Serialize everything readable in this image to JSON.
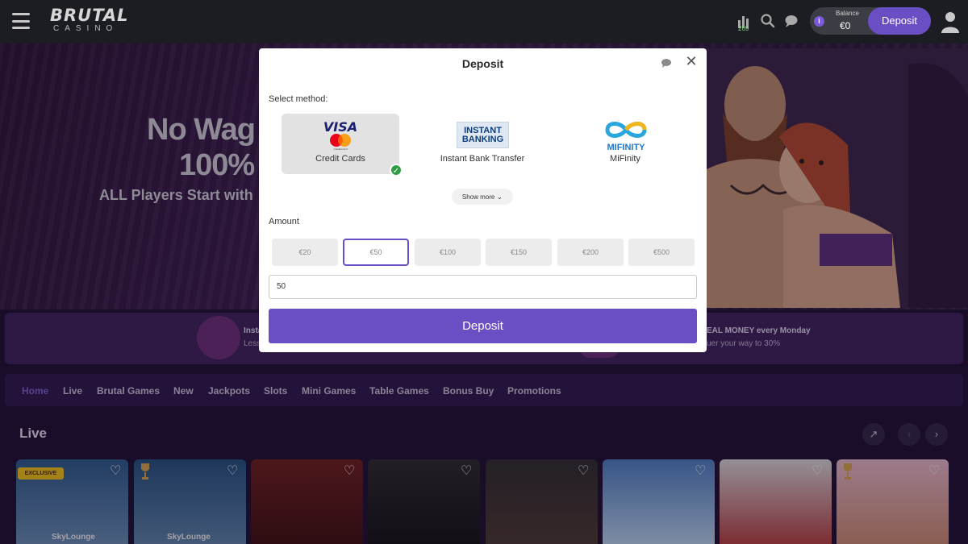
{
  "header": {
    "logo_main": "BRUTAL",
    "logo_sub": "CASINO",
    "stats_count": "269",
    "balance_label": "Balance",
    "balance_value": "€0",
    "deposit_label": "Deposit"
  },
  "hero": {
    "line1": "No Wag",
    "line2": "100%",
    "line3": "ALL Players Start with"
  },
  "promo": {
    "left_title": "Insta",
    "left_sub": "Less",
    "right_title": "EAL MONEY every Monday",
    "right_sub": "uer your way to 30%"
  },
  "nav": {
    "items": [
      "Home",
      "Live",
      "Brutal Games",
      "New",
      "Jackpots",
      "Slots",
      "Mini Games",
      "Table Games",
      "Bonus Buy",
      "Promotions"
    ]
  },
  "live": {
    "title": "Live",
    "exclusive_badge": "EXCLUSIVE",
    "card_captions": [
      "SkyLounge",
      "SkyLounge"
    ]
  },
  "modal": {
    "title": "Deposit",
    "select_label": "Select method:",
    "methods": [
      {
        "logo_text": "VISA",
        "logo_sub": "mastercard",
        "name": "Credit Cards"
      },
      {
        "logo_text_1": "INSTANT",
        "logo_text_2": "BANKING",
        "name": "Instant Bank Transfer"
      },
      {
        "logo_text": "MIFINITY",
        "name": "MiFinity"
      }
    ],
    "show_more": "Show more",
    "amount_label": "Amount",
    "amounts": [
      "€20",
      "€50",
      "€100",
      "€150",
      "€200",
      "€500"
    ],
    "amount_value": "50",
    "deposit_button": "Deposit"
  },
  "colors": {
    "accent": "#6a4fc4",
    "header_bg": "#1b1d22",
    "success": "#2e9e44"
  },
  "icons": {
    "menu": "hamburger-icon",
    "stats": "bar-chart-icon",
    "search": "search-icon",
    "chat": "chat-icon",
    "info": "info-icon",
    "user": "user-icon",
    "close": "close-icon",
    "check": "check-icon",
    "chevron": "chevron-down-icon",
    "heart": "heart-icon",
    "trophy": "trophy-icon",
    "external": "external-link-icon",
    "prev": "chevron-left-icon",
    "next": "chevron-right-icon"
  }
}
